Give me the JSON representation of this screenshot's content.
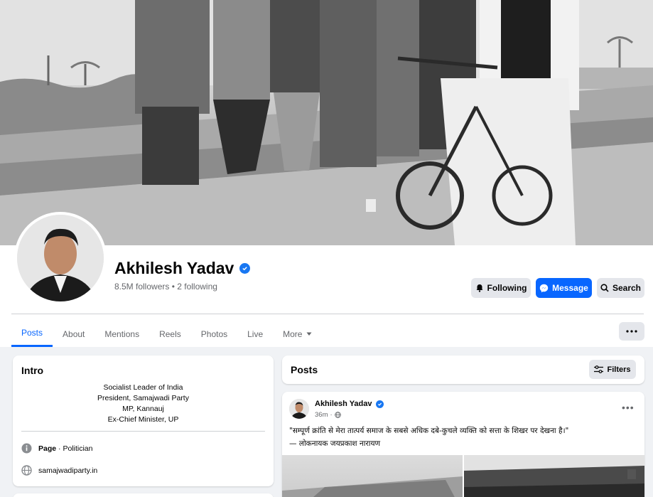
{
  "profile": {
    "name": "Akhilesh Yadav",
    "followers_text": "8.5M followers • 2 following"
  },
  "actions": {
    "following_label": "Following",
    "message_label": "Message",
    "search_label": "Search"
  },
  "tabs": [
    {
      "label": "Posts",
      "active": true
    },
    {
      "label": "About"
    },
    {
      "label": "Mentions"
    },
    {
      "label": "Reels"
    },
    {
      "label": "Photos"
    },
    {
      "label": "Live"
    },
    {
      "label": "More"
    }
  ],
  "intro": {
    "title": "Intro",
    "bio_lines": [
      "Socialist Leader of India",
      "President, Samajwadi Party",
      "MP, Kannauj",
      "Ex-Chief Minister, UP"
    ],
    "page_type_bold": "Page",
    "page_type_rest": " · Politician",
    "website": "samajwadiparty.in"
  },
  "posts": {
    "title": "Posts",
    "filters_label": "Filters"
  },
  "post": {
    "author": "Akhilesh Yadav",
    "time": "36m",
    "quote": "\"सम्पूर्ण क्रांति से मेरा तात्पर्य समाज के सबसे अधिक दबे-कुचले व्यक्ति को सत्ता के शिखर पर देखना है।\"",
    "attribution": "— लोकनायक जयप्रकाश नारायण"
  },
  "colors": {
    "accent": "#0866ff",
    "verified": "#1877f2",
    "background": "#f0f2f5",
    "secondary_text": "#65676b"
  }
}
